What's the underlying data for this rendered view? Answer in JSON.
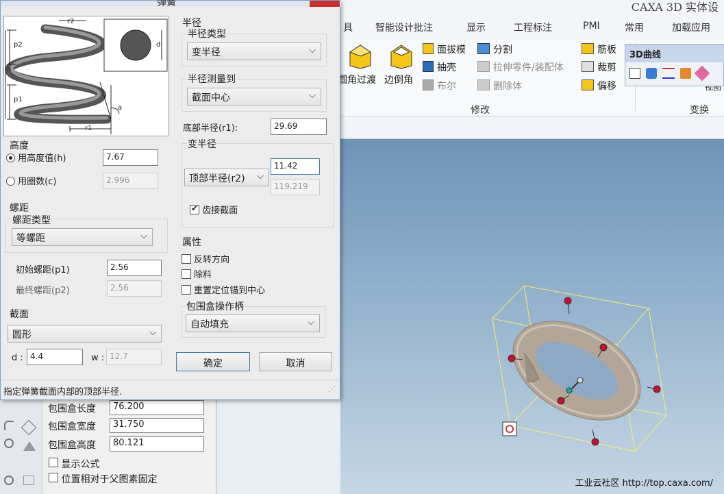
{
  "app": {
    "title": "CAXA 3D 实体设"
  },
  "menu": [
    "具",
    "智能设计批注",
    "显示",
    "工程标注",
    "PMI",
    "常用",
    "加载应用"
  ],
  "ribbon": {
    "big_buttons": [
      "圆角过渡",
      "边倒角"
    ],
    "col1": [
      "面拔模",
      "抽壳",
      "布尔"
    ],
    "col2": [
      "分割",
      "拉伸零件/装配体",
      "删除体"
    ],
    "col3": [
      "筋板",
      "裁剪",
      "偏移"
    ],
    "group_modify": "修改",
    "group_transform": "变换",
    "partial_label": "视图"
  },
  "curve_toolbar": {
    "title": "3D曲线"
  },
  "dialog": {
    "title": "弹簧",
    "preview": {
      "r2": "r2",
      "p2": "p2",
      "h": "h",
      "p1": "p1",
      "a": "a",
      "r1": "r1",
      "d": "d"
    },
    "height": {
      "group": "高度",
      "by_height": "用高度值(h)",
      "height_value": "7.67",
      "by_turns": "用圈数(c)",
      "turns_value": "2.996",
      "selected": "by_height"
    },
    "pitch": {
      "group": "螺距",
      "type_label": "螺距类型",
      "type_value": "等螺距",
      "initial_label": "初始螺距(p1)",
      "initial_value": "2.56",
      "final_label": "最终螺距(p2)",
      "final_value": "2.56"
    },
    "section": {
      "group": "截面",
      "shape": "圆形",
      "d_label": "d :",
      "d_value": "4.4",
      "w_label": "w :",
      "w_value": "12.7"
    },
    "radius": {
      "group": "半径",
      "type_label": "半径类型",
      "type_value": "变半径",
      "measure_label": "半径测量到",
      "measure_value": "截面中心",
      "bottom_label": "底部半径(r1):",
      "bottom_value": "29.69",
      "var_group": "变半径",
      "var_select": "顶部半径(r2)",
      "var_value": "11.42",
      "var_ref": "119.219",
      "butt_label": "齿接截面",
      "butt_checked": true
    },
    "props": {
      "group": "属性",
      "reverse": "反转方向",
      "remove": "除料",
      "reset_anchor": "重置定位锚到中心",
      "handle_group": "包围盒操作柄",
      "handle_value": "自动填充"
    },
    "ok": "确定",
    "cancel": "取消",
    "status": "指定弹簧截面内部的顶部半径."
  },
  "panel": {
    "rows": [
      {
        "label": "包围盒长度",
        "value": "76.200"
      },
      {
        "label": "包围盒宽度",
        "value": "31.750"
      },
      {
        "label": "包围盒高度",
        "value": "80.121"
      }
    ],
    "show_formula": "显示公式",
    "fixed_to_parent": "位置相对于父图素固定"
  },
  "watermark": "工业云社区 http://top.caxa.com/",
  "colors": {
    "handle_red": "#c8102e",
    "bbox_yellow": "#f2f26a",
    "torus": "#b5a99b"
  }
}
